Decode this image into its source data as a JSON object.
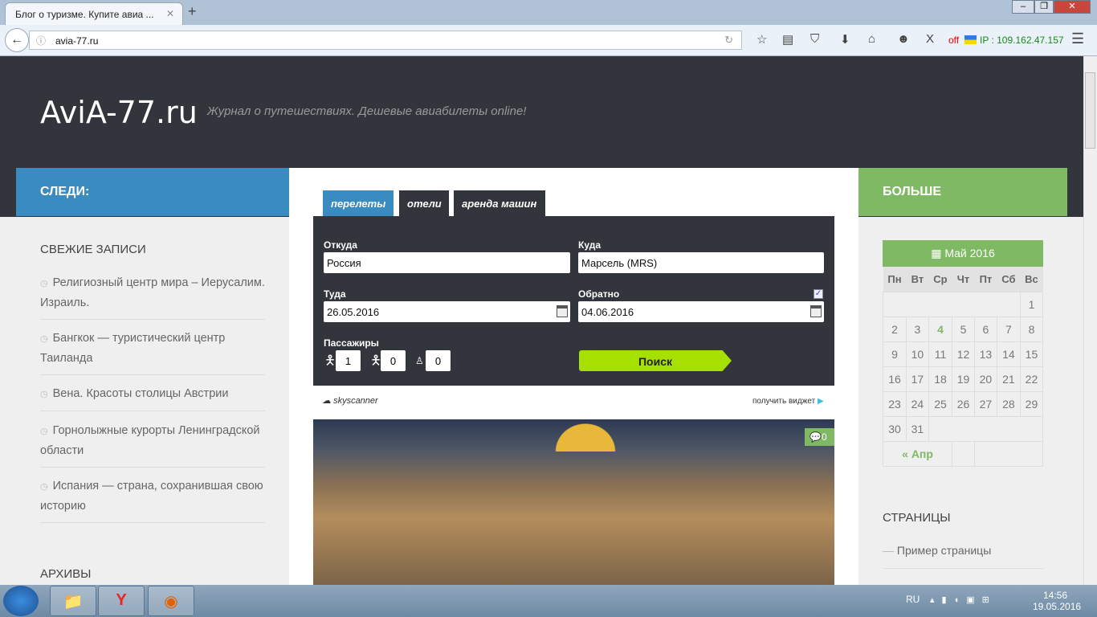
{
  "browser": {
    "tab_title": "Блог о туризме. Купите авиа ...",
    "url": "avia-77.ru",
    "vpn_status": "off",
    "ip_text": "IP : 109.162.47.157"
  },
  "site": {
    "logo": "AviA-77.ru",
    "tagline": "Журнал о путешествиях. Дешевые авиабилеты online!"
  },
  "left": {
    "header": "СЛЕДИ:",
    "recent_title": "СВЕЖИЕ ЗАПИСИ",
    "posts": [
      "Религиозный центр мира – Иерусалим. Израиль.",
      "Бангкок — туристический центр Таиланда",
      "Вена. Красоты столицы Австрии",
      "Горнолыжные курорты Ленинградской области",
      "Испания — страна, сохранившая свою историю"
    ],
    "archives_title": "АРХИВЫ"
  },
  "widget": {
    "tabs": [
      "перелеты",
      "отели",
      "аренда машин"
    ],
    "from_label": "Откуда",
    "from_value": "Россия",
    "to_label": "Куда",
    "to_value": "Марсель (MRS)",
    "depart_label": "Туда",
    "depart_value": "26.05.2016",
    "return_label": "Обратно",
    "return_value": "04.06.2016",
    "return_checked": true,
    "passengers_label": "Пассажиры",
    "adults": "1",
    "children": "0",
    "infants": "0",
    "search_label": "Поиск",
    "brand": "skyscanner",
    "get_widget": "получить виджет"
  },
  "post": {
    "comments": "0"
  },
  "right": {
    "header": "БОЛЬШЕ",
    "calendar_title": "Май 2016",
    "weekdays": [
      "Пн",
      "Вт",
      "Ср",
      "Чт",
      "Пт",
      "Сб",
      "Вс"
    ],
    "highlight": "4",
    "prev_link": "« Апр",
    "pages_title": "СТРАНИЦЫ",
    "pages": [
      "Пример страницы"
    ]
  },
  "taskbar": {
    "lang": "RU",
    "time": "14:56",
    "date": "19.05.2016"
  }
}
